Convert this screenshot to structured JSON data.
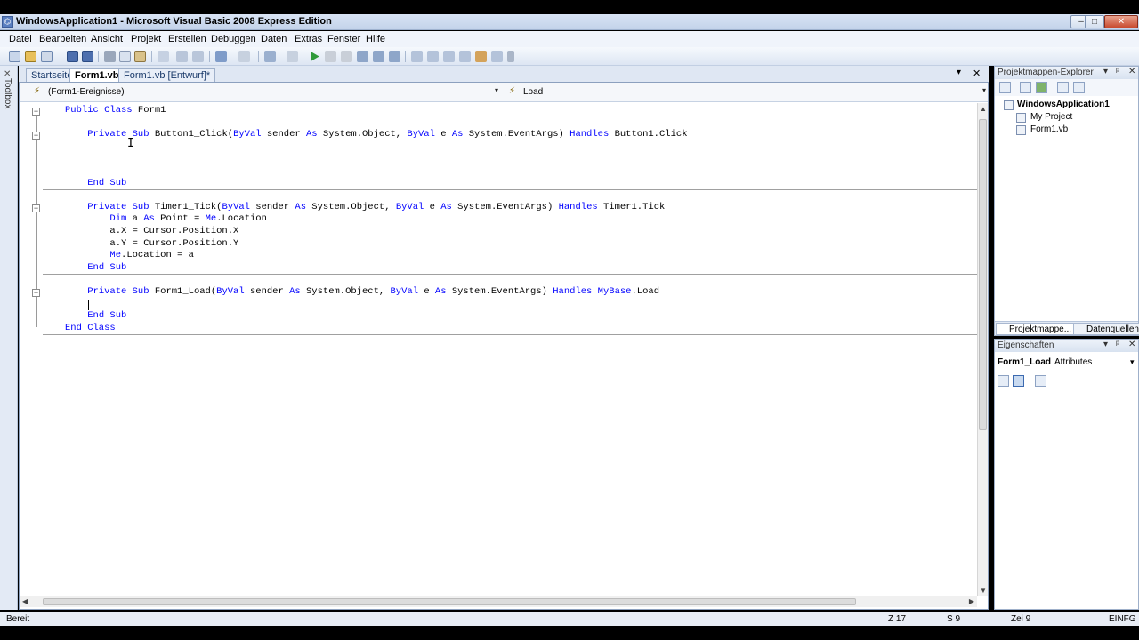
{
  "window": {
    "title": "WindowsApplication1 - Microsoft Visual Basic 2008 Express Edition",
    "min": "–",
    "max": "□",
    "close": "✕"
  },
  "menu": [
    "Datei",
    "Bearbeiten",
    "Ansicht",
    "Projekt",
    "Erstellen",
    "Debuggen",
    "Daten",
    "Extras",
    "Fenster",
    "Hilfe"
  ],
  "toolbox": {
    "label": "Toolbox",
    "icon": "✕"
  },
  "tabs": [
    {
      "label": "Startseite",
      "active": false
    },
    {
      "label": "Form1.vb*",
      "active": true
    },
    {
      "label": "Form1.vb [Entwurf]*",
      "active": false
    }
  ],
  "doc_controls": {
    "dropdown": "▾",
    "close": "✕"
  },
  "nav": {
    "object": "(Form1-Ereignisse)",
    "method": "Load",
    "arrow": "▾",
    "object_icon": "⚡",
    "method_icon": "⚡"
  },
  "code": [
    [
      [
        "kw",
        "Public Class "
      ],
      [
        "",
        "Form1"
      ]
    ],
    [
      [
        "",
        ""
      ]
    ],
    [
      [
        "",
        "    "
      ],
      [
        "kw",
        "Private Sub "
      ],
      [
        "",
        "Button1_Click("
      ],
      [
        "kw",
        "ByVal "
      ],
      [
        "",
        "sender "
      ],
      [
        "kw",
        "As "
      ],
      [
        "",
        "System.Object, "
      ],
      [
        "kw",
        "ByVal "
      ],
      [
        "",
        "e "
      ],
      [
        "kw",
        "As "
      ],
      [
        "",
        "System.EventArgs) "
      ],
      [
        "kw",
        "Handles "
      ],
      [
        "",
        "Button1.Click"
      ]
    ],
    [
      [
        "",
        ""
      ]
    ],
    [
      [
        "",
        ""
      ]
    ],
    [
      [
        "",
        ""
      ]
    ],
    [
      [
        "",
        "    "
      ],
      [
        "kw",
        "End Sub"
      ]
    ],
    [
      [
        "",
        ""
      ]
    ],
    [
      [
        "",
        "    "
      ],
      [
        "kw",
        "Private Sub "
      ],
      [
        "",
        "Timer1_Tick("
      ],
      [
        "kw",
        "ByVal "
      ],
      [
        "",
        "sender "
      ],
      [
        "kw",
        "As "
      ],
      [
        "",
        "System.Object, "
      ],
      [
        "kw",
        "ByVal "
      ],
      [
        "",
        "e "
      ],
      [
        "kw",
        "As "
      ],
      [
        "",
        "System.EventArgs) "
      ],
      [
        "kw",
        "Handles "
      ],
      [
        "",
        "Timer1.Tick"
      ]
    ],
    [
      [
        "",
        "        "
      ],
      [
        "kw",
        "Dim "
      ],
      [
        "",
        "a "
      ],
      [
        "kw",
        "As "
      ],
      [
        "",
        "Point = "
      ],
      [
        "kw",
        "Me"
      ],
      [
        "",
        ".Location"
      ]
    ],
    [
      [
        "",
        "        a.X = Cursor.Position.X"
      ]
    ],
    [
      [
        "",
        "        a.Y = Cursor.Position.Y"
      ]
    ],
    [
      [
        "",
        "        "
      ],
      [
        "kw",
        "Me"
      ],
      [
        "",
        ".Location = a"
      ]
    ],
    [
      [
        "",
        "    "
      ],
      [
        "kw",
        "End Sub"
      ]
    ],
    [
      [
        "",
        ""
      ]
    ],
    [
      [
        "",
        "    "
      ],
      [
        "kw",
        "Private Sub "
      ],
      [
        "",
        "Form1_Load("
      ],
      [
        "kw",
        "ByVal "
      ],
      [
        "",
        "sender "
      ],
      [
        "kw",
        "As "
      ],
      [
        "",
        "System.Object, "
      ],
      [
        "kw",
        "ByVal "
      ],
      [
        "",
        "e "
      ],
      [
        "kw",
        "As "
      ],
      [
        "",
        "System.EventArgs) "
      ],
      [
        "kw",
        "Handles "
      ],
      [
        "kw",
        "MyBase"
      ],
      [
        "",
        ".Load"
      ]
    ],
    [
      [
        "",
        ""
      ]
    ],
    [
      [
        "",
        "    "
      ],
      [
        "kw",
        "End Sub"
      ]
    ],
    [
      [
        "kw",
        "End Class"
      ]
    ]
  ],
  "fold_symbol": "−",
  "ibeam": "I",
  "solution_explorer": {
    "title": "Projektmappen-Explorer",
    "pin": "▾",
    "pin2": "ᵖ",
    "close": "✕",
    "root": "WindowsApplication1",
    "items": [
      "My Project",
      "Form1.vb"
    ],
    "tabs": [
      "Projektmappe...",
      "Datenquellen"
    ]
  },
  "properties": {
    "title": "Eigenschaften",
    "pin": "▾",
    "pin2": "ᵖ",
    "close": "✕",
    "object_name": "Form1_Load",
    "object_type": "Attributes",
    "arrow": "▾"
  },
  "status": {
    "text": "Bereit",
    "line": "Z 17",
    "col": "S 9",
    "char": "Zei 9",
    "mode": "EINFG"
  },
  "colors": {
    "keyword": "#0000ff"
  }
}
